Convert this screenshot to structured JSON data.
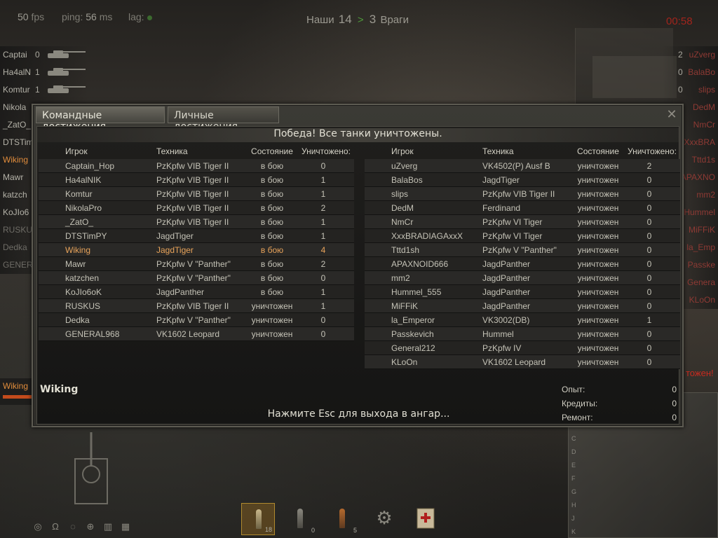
{
  "hud": {
    "fps_value": "50",
    "fps_label": "fps",
    "ping_label": "ping:",
    "ping_value": "56",
    "ping_unit": "ms",
    "lag_label": "lag:",
    "team_ours_label": "Наши",
    "score_ours": "14",
    "score_arrow": ">",
    "score_enemy": "3",
    "team_enemy_label": "Враги",
    "timer": "00:58"
  },
  "side_allies": [
    {
      "name": "Captai",
      "frags": "0",
      "state": "alive"
    },
    {
      "name": "Ha4alN",
      "frags": "1",
      "state": "alive"
    },
    {
      "name": "Komtur",
      "frags": "1",
      "state": "alive"
    },
    {
      "name": "Nikola",
      "frags": "",
      "state": "alive"
    },
    {
      "name": "_ZatO_",
      "frags": "",
      "state": "alive"
    },
    {
      "name": "DTSTim",
      "frags": "",
      "state": "alive"
    },
    {
      "name": "Wiking",
      "frags": "",
      "state": "self"
    },
    {
      "name": "Mawr",
      "frags": "",
      "state": "alive"
    },
    {
      "name": "katzch",
      "frags": "",
      "state": "alive"
    },
    {
      "name": "KoJIo6",
      "frags": "",
      "state": "alive"
    },
    {
      "name": "RUSKUS",
      "frags": "",
      "state": "dead"
    },
    {
      "name": "Dedka",
      "frags": "",
      "state": "dead"
    },
    {
      "name": "GENERA",
      "frags": "",
      "state": "dead"
    }
  ],
  "side_enemies": [
    {
      "name": "uZverg",
      "frags": "2"
    },
    {
      "name": "BalaBo",
      "frags": "0"
    },
    {
      "name": "slips",
      "frags": "0"
    },
    {
      "name": "DedM",
      "frags": ""
    },
    {
      "name": "NmCr",
      "frags": ""
    },
    {
      "name": "XxxBRA",
      "frags": ""
    },
    {
      "name": "Tttd1s",
      "frags": ""
    },
    {
      "name": "APAXNO",
      "frags": ""
    },
    {
      "name": "mm2",
      "frags": ""
    },
    {
      "name": "Hummel",
      "frags": ""
    },
    {
      "name": "MiFFiK",
      "frags": ""
    },
    {
      "name": "la_Emp",
      "frags": ""
    },
    {
      "name": "Passke",
      "frags": ""
    },
    {
      "name": "Genera",
      "frags": ""
    },
    {
      "name": "KLoOn",
      "frags": ""
    }
  ],
  "dialog": {
    "tab_team": "Командные достижения",
    "tab_personal": "Личные достижения",
    "close": "✕",
    "banner": "Победа! Все танки уничтожены.",
    "columns": {
      "player": "Игрок",
      "vehicle": "Техника",
      "state": "Состояние",
      "kills": "Уничтожено:"
    },
    "allies": [
      {
        "name": "Captain_Hop",
        "tank": "PzKpfw VIB Tiger II",
        "state": "в бою",
        "kills": "0"
      },
      {
        "name": "Ha4alNIK",
        "tank": "PzKpfw VIB Tiger II",
        "state": "в бою",
        "kills": "1"
      },
      {
        "name": "Komtur",
        "tank": "PzKpfw VIB Tiger II",
        "state": "в бою",
        "kills": "1"
      },
      {
        "name": "NikolaPro",
        "tank": "PzKpfw VIB Tiger II",
        "state": "в бою",
        "kills": "2"
      },
      {
        "name": "_ZatO_",
        "tank": "PzKpfw VIB Tiger II",
        "state": "в бою",
        "kills": "1"
      },
      {
        "name": "DTSTimPY",
        "tank": "JagdTiger",
        "state": "в бою",
        "kills": "1"
      },
      {
        "name": "Wiking",
        "tank": "JagdTiger",
        "state": "в бою",
        "kills": "4",
        "self": true
      },
      {
        "name": "Mawr",
        "tank": "PzKpfw V \"Panther\"",
        "state": "в бою",
        "kills": "2"
      },
      {
        "name": "katzchen",
        "tank": "PzKpfw V \"Panther\"",
        "state": "в бою",
        "kills": "0"
      },
      {
        "name": "KoJIo6oK",
        "tank": "JagdPanther",
        "state": "в бою",
        "kills": "1"
      },
      {
        "name": "RUSKUS",
        "tank": "PzKpfw VIB Tiger II",
        "state": "уничтожен",
        "kills": "1"
      },
      {
        "name": "Dedka",
        "tank": "PzKpfw V \"Panther\"",
        "state": "уничтожен",
        "kills": "0"
      },
      {
        "name": "GENERAL968",
        "tank": "VK1602 Leopard",
        "state": "уничтожен",
        "kills": "0"
      }
    ],
    "enemies": [
      {
        "name": "uZverg",
        "tank": "VK4502(P) Ausf B",
        "state": "уничтожен",
        "kills": "2"
      },
      {
        "name": "BalaBos",
        "tank": "JagdTiger",
        "state": "уничтожен",
        "kills": "0"
      },
      {
        "name": "slips",
        "tank": "PzKpfw VIB Tiger II",
        "state": "уничтожен",
        "kills": "0"
      },
      {
        "name": "DedM",
        "tank": "Ferdinand",
        "state": "уничтожен",
        "kills": "0"
      },
      {
        "name": "NmCr",
        "tank": "PzKpfw VI Tiger",
        "state": "уничтожен",
        "kills": "0"
      },
      {
        "name": "XxxBRADIAGAxxX",
        "tank": "PzKpfw VI Tiger",
        "state": "уничтожен",
        "kills": "0"
      },
      {
        "name": "Tttd1sh",
        "tank": "PzKpfw V \"Panther\"",
        "state": "уничтожен",
        "kills": "0"
      },
      {
        "name": "APAXNOID666",
        "tank": "JagdPanther",
        "state": "уничтожен",
        "kills": "0"
      },
      {
        "name": "mm2",
        "tank": "JagdPanther",
        "state": "уничтожен",
        "kills": "0"
      },
      {
        "name": "Hummel_555",
        "tank": "JagdPanther",
        "state": "уничтожен",
        "kills": "0"
      },
      {
        "name": "MiFFiK",
        "tank": "JagdPanther",
        "state": "уничтожен",
        "kills": "0"
      },
      {
        "name": "la_Emperor",
        "tank": "VK3002(DB)",
        "state": "уничтожен",
        "kills": "1"
      },
      {
        "name": "Passkevich",
        "tank": "Hummel",
        "state": "уничтожен",
        "kills": "0"
      },
      {
        "name": "General212",
        "tank": "PzKpfw IV",
        "state": "уничтожен",
        "kills": "0"
      },
      {
        "name": "KLoOn",
        "tank": "VK1602 Leopard",
        "state": "уничтожен",
        "kills": "0"
      }
    ],
    "player_name": "Wiking",
    "esc_hint": "Нажмите Esc для выхода в ангар...",
    "results": [
      {
        "label": "Опыт:",
        "value": "0"
      },
      {
        "label": "Кредиты:",
        "value": "0"
      },
      {
        "label": "Ремонт:",
        "value": "0"
      }
    ]
  },
  "hud_bottom": {
    "self_name": "Wiking",
    "self_hp_fraction": 1.0,
    "destroyed_note": "тожен!",
    "minimap_rows": [
      "C",
      "D",
      "E",
      "F",
      "G",
      "H",
      "J",
      "K"
    ],
    "ammo_counts": [
      "18",
      "0",
      "5"
    ]
  },
  "colors": {
    "self": "#e8a35a",
    "enemy_dead": "#8e3a34",
    "victory_arrow": "#4e9a3a",
    "timer": "#a1241c"
  }
}
